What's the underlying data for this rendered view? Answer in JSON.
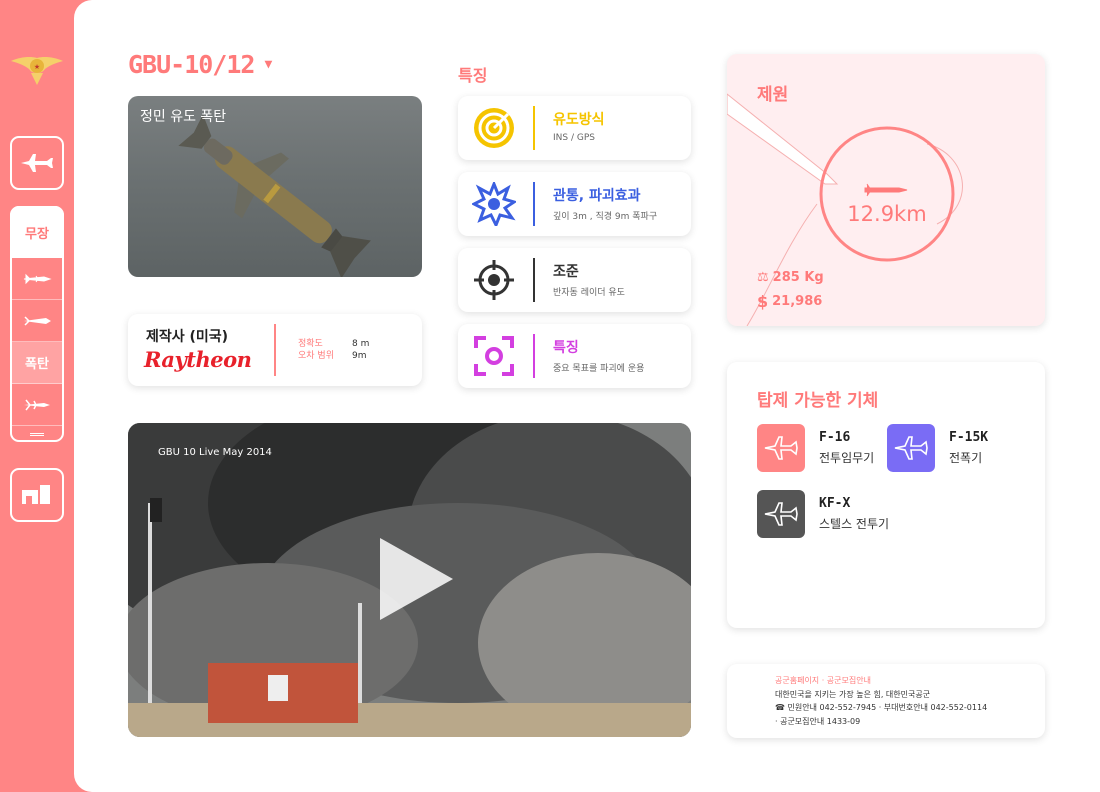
{
  "sidebar": {
    "nav_aircraft_icon": "fighter-jet-icon",
    "armament_label": "무장",
    "sub_items": [
      {
        "icon": "missile-icon",
        "label": ""
      },
      {
        "icon": "cruise-missile-icon",
        "label": ""
      },
      {
        "icon": "bomb-icon",
        "label": "폭탄"
      },
      {
        "icon": "rocket-icon",
        "label": ""
      }
    ],
    "nav_facility_icon": "facility-icon"
  },
  "header": {
    "title": "GBU-10/12",
    "dropdown_icon": "caret-down-icon"
  },
  "bomb_image": {
    "caption": "정민 유도 폭탄"
  },
  "manufacturer": {
    "label": "제작사 (미국)",
    "name": "Raytheon",
    "stats": [
      {
        "key": "정확도",
        "value": "8 m"
      },
      {
        "key": "오차 범위",
        "value": "9m"
      }
    ]
  },
  "features": {
    "heading": "특징",
    "items": [
      {
        "title": "유도방식",
        "desc": "INS / GPS",
        "icon": "target-rings-icon",
        "color": "#f5c400"
      },
      {
        "title": "관통, 파괴효과",
        "desc": "깊이 3m , 직경 9m 폭파구",
        "icon": "explosion-icon",
        "color": "#3b5fe0"
      },
      {
        "title": "조준",
        "desc": "반자동 레이더 유도",
        "icon": "crosshair-icon",
        "color": "#333333"
      },
      {
        "title": "특징",
        "desc": "중요 목표를 파괴에 운용",
        "icon": "focus-icon",
        "color": "#d33fe0"
      }
    ]
  },
  "video": {
    "caption": "GBU 10 Live May 2014",
    "container_label": "1"
  },
  "specs": {
    "heading": "제원",
    "range": "12.9km",
    "weight": "285 Kg",
    "price": "21,986"
  },
  "aircraft": {
    "heading": "탑제 가능한 기체",
    "items": [
      {
        "name": "F-16",
        "type": "전투임무기",
        "color": "#ff8585"
      },
      {
        "name": "F-15K",
        "type": "전폭기",
        "color": "#7a6cf5"
      },
      {
        "name": "KF-X",
        "type": "스텔스 전투기",
        "color": "#555555"
      }
    ]
  },
  "footer": {
    "links": "공군홈페이지 · 공군모집안내",
    "slogan": "대한민국을 지키는 가장 높은 힘, 대한민국공군",
    "contact1": "☎ 민원안내   042-552-7945  · 부대번호안내   042-552-0114",
    "contact2": "· 공군모집안내   1433-09"
  },
  "colors": {
    "accent": "#ff8585",
    "accent_text": "#ff7a7a"
  }
}
